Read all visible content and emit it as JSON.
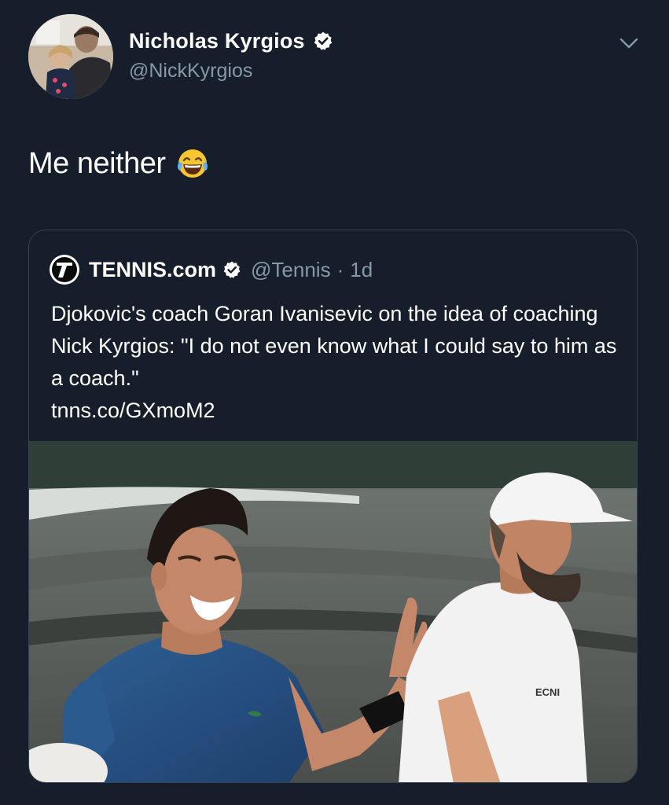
{
  "tweet": {
    "author_name": "Nicholas Kyrgios",
    "author_handle": "@NickKyrgios",
    "verified": true,
    "text": "Me neither",
    "emoji_icon": "face-with-tears-of-joy-icon"
  },
  "quoted": {
    "source_name": "TENNIS.com",
    "handle": "@Tennis",
    "separator": "·",
    "time": "1d",
    "verified": true,
    "text": "Djokovic's coach Goran Ivanisevic on the idea of coaching Nick Kyrgios: \"I do not even know what I could say to him as a coach.\"",
    "link": "tnns.co/GXmoM2",
    "media_shirt_text": "ECNI"
  },
  "colors": {
    "background": "#161d2b",
    "text_primary": "#ffffff",
    "text_secondary": "#8899a6",
    "border": "#38444d",
    "verified_badge": "#ffffff"
  }
}
